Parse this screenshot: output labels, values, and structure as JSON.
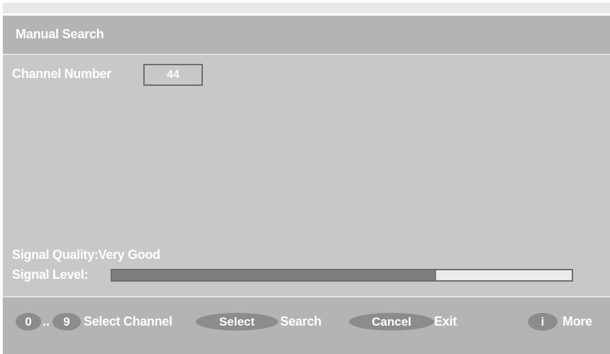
{
  "window": {
    "title": "Manual Search"
  },
  "channel": {
    "label": "Channel Number",
    "value": "44"
  },
  "signal": {
    "quality_label": "Signal Quality:",
    "quality_value": "Very Good",
    "level_label": "Signal Level:",
    "level_fraction": 0.705
  },
  "footer": {
    "key_0": "0",
    "range_separator": "..",
    "key_9": "9",
    "select_channel_label": "Select Channel",
    "select_key": "Select",
    "search_label": "Search",
    "cancel_key": "Cancel",
    "exit_label": "Exit",
    "info_key": "i",
    "more_label": "More"
  },
  "colors": {
    "title_bar": "#b4b4b4",
    "content_bg": "#c8c8c8",
    "pill_bg": "#8c8c8c",
    "bar_fill": "#7d7d7d",
    "text": "#ffffff"
  }
}
